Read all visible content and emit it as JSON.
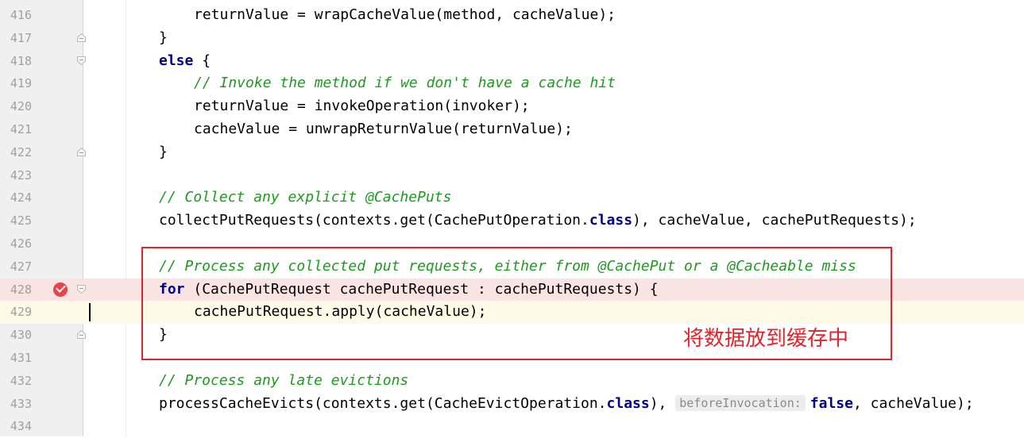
{
  "editor": {
    "lines": [
      {
        "num": "416",
        "indent": 2,
        "segments": [
          {
            "t": "returnValue = wrapCacheValue(method, cacheValue);",
            "c": "plain"
          }
        ]
      },
      {
        "num": "417",
        "indent": 1,
        "fold": "end",
        "segments": [
          {
            "t": "}",
            "c": "plain"
          }
        ]
      },
      {
        "num": "418",
        "indent": 1,
        "fold": "start",
        "segments": [
          {
            "t": "else",
            "c": "kw"
          },
          {
            "t": " {",
            "c": "plain"
          }
        ]
      },
      {
        "num": "419",
        "indent": 2,
        "segments": [
          {
            "t": "// Invoke the method if we don't have a cache hit",
            "c": "cm"
          }
        ]
      },
      {
        "num": "420",
        "indent": 2,
        "segments": [
          {
            "t": "returnValue = invokeOperation(invoker);",
            "c": "plain"
          }
        ]
      },
      {
        "num": "421",
        "indent": 2,
        "segments": [
          {
            "t": "cacheValue = unwrapReturnValue(returnValue);",
            "c": "plain"
          }
        ]
      },
      {
        "num": "422",
        "indent": 1,
        "fold": "end",
        "segments": [
          {
            "t": "}",
            "c": "plain"
          }
        ]
      },
      {
        "num": "423",
        "indent": 1,
        "segments": []
      },
      {
        "num": "424",
        "indent": 1,
        "segments": [
          {
            "t": "// Collect any explicit @CachePuts",
            "c": "cm"
          }
        ]
      },
      {
        "num": "425",
        "indent": 1,
        "segments": [
          {
            "t": "collectPutRequests(contexts.get(CachePutOperation.",
            "c": "plain"
          },
          {
            "t": "class",
            "c": "kw"
          },
          {
            "t": "), cacheValue, cachePutRequests);",
            "c": "plain"
          }
        ]
      },
      {
        "num": "426",
        "indent": 1,
        "segments": []
      },
      {
        "num": "427",
        "indent": 1,
        "segments": [
          {
            "t": "// Process any collected put requests, either from @CachePut or a @Cacheable miss",
            "c": "cm"
          }
        ]
      },
      {
        "num": "428",
        "indent": 1,
        "fold": "start",
        "breakpoint": true,
        "segments": [
          {
            "t": "for",
            "c": "kw"
          },
          {
            "t": " (CachePutRequest cachePutRequest : cachePutRequests) {",
            "c": "plain"
          }
        ]
      },
      {
        "num": "429",
        "indent": 2,
        "caret": true,
        "segments": [
          {
            "t": "cachePutRequest.apply(cacheValue);",
            "c": "plain"
          }
        ]
      },
      {
        "num": "430",
        "indent": 1,
        "fold": "end",
        "segments": [
          {
            "t": "}",
            "c": "plain"
          }
        ]
      },
      {
        "num": "431",
        "indent": 1,
        "segments": []
      },
      {
        "num": "432",
        "indent": 1,
        "segments": [
          {
            "t": "// Process any late evictions",
            "c": "cm"
          }
        ]
      },
      {
        "num": "433",
        "indent": 1,
        "segments": [
          {
            "t": "processCacheEvicts(contexts.get(CacheEvictOperation.",
            "c": "plain"
          },
          {
            "t": "class",
            "c": "kw"
          },
          {
            "t": "), ",
            "c": "plain"
          },
          {
            "t": "beforeInvocation:",
            "c": "hint"
          },
          {
            "t": "false",
            "c": "kw"
          },
          {
            "t": ", cacheValue);",
            "c": "plain"
          }
        ]
      },
      {
        "num": "434",
        "indent": 1,
        "segments": []
      }
    ]
  },
  "annotation": {
    "label": "将数据放到缓存中",
    "color": "#e0242c"
  },
  "colors": {
    "keyword": "#000080",
    "comment": "#1e9a1e",
    "breakpoint_line": "#fae3e3",
    "caret_line": "#fdfae7",
    "gutter": "#f0f0f0"
  }
}
